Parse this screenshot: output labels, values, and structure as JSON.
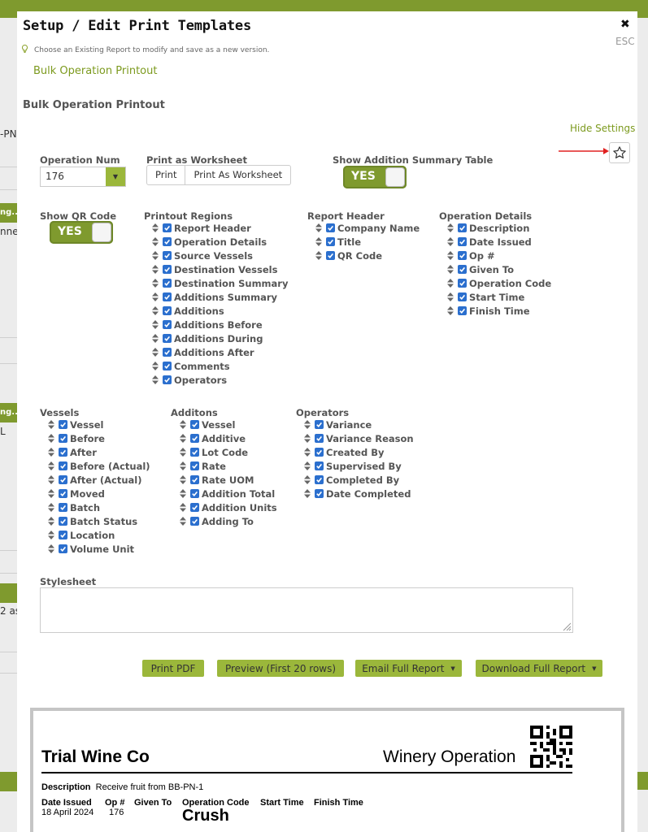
{
  "background": {
    "snippets": [
      "-PN-",
      "ng...",
      "nne",
      "ng...",
      "L",
      "2 as"
    ]
  },
  "modal": {
    "title": "Setup / Edit Print Templates",
    "close_label": "✖",
    "esc_label": "ESC",
    "tip": "Choose an Existing Report to modify and save as a new version.",
    "existing_report": "Bulk Operation Printout",
    "section_title": "Bulk Operation Printout",
    "hide_settings": "Hide Settings"
  },
  "settings": {
    "operation_num": {
      "label": "Operation Num",
      "value": "176"
    },
    "print_as_worksheet": {
      "label": "Print as Worksheet",
      "options": [
        "Print",
        "Print As Worksheet"
      ]
    },
    "show_addition_summary": {
      "label": "Show Addition Summary Table",
      "value": "YES"
    },
    "show_qr": {
      "label": "Show QR Code",
      "value": "YES"
    }
  },
  "columns": {
    "printout_regions": {
      "label": "Printout Regions",
      "items": [
        "Report Header",
        "Operation Details",
        "Source Vessels",
        "Destination Vessels",
        "Destination Summary",
        "Additions Summary",
        "Additions",
        "Additions Before",
        "Additions During",
        "Additions After",
        "Comments",
        "Operators"
      ]
    },
    "report_header": {
      "label": "Report Header",
      "items": [
        "Company Name",
        "Title",
        "QR Code"
      ]
    },
    "operation_details": {
      "label": "Operation Details",
      "items": [
        "Description",
        "Date Issued",
        "Op #",
        "Given To",
        "Operation Code",
        "Start Time",
        "Finish Time"
      ]
    },
    "vessels": {
      "label": "Vessels",
      "items": [
        "Vessel",
        "Before",
        "After",
        "Before (Actual)",
        "After (Actual)",
        "Moved",
        "Batch",
        "Batch Status",
        "Location",
        "Volume Unit"
      ]
    },
    "additons": {
      "label": "Additons",
      "items": [
        "Vessel",
        "Additive",
        "Lot Code",
        "Rate",
        "Rate UOM",
        "Addition Total",
        "Addition Units",
        "Adding To"
      ]
    },
    "operators": {
      "label": "Operators",
      "items": [
        "Variance",
        "Variance Reason",
        "Created By",
        "Supervised By",
        "Completed By",
        "Date Completed"
      ]
    }
  },
  "stylesheet": {
    "label": "Stylesheet",
    "value": ""
  },
  "buttons": {
    "print_pdf": "Print PDF",
    "preview": "Preview (First 20 rows)",
    "email": "Email Full Report",
    "download": "Download Full Report"
  },
  "preview": {
    "company": "Trial Wine Co",
    "report_type": "Winery Operation",
    "description_label": "Description",
    "description_value": "Receive fruit from BB-PN-1",
    "headers": [
      "Date Issued",
      "Op #",
      "Given To",
      "Operation Code",
      "Start Time",
      "Finish Time"
    ],
    "date_issued": "18 April 2024",
    "op_num": "176",
    "operation_code": "Crush"
  },
  "colors": {
    "accent": "#9bb73b",
    "toggle": "#7f9a2e",
    "link": "#7c9a1e",
    "checkbox": "#2b6fce"
  }
}
